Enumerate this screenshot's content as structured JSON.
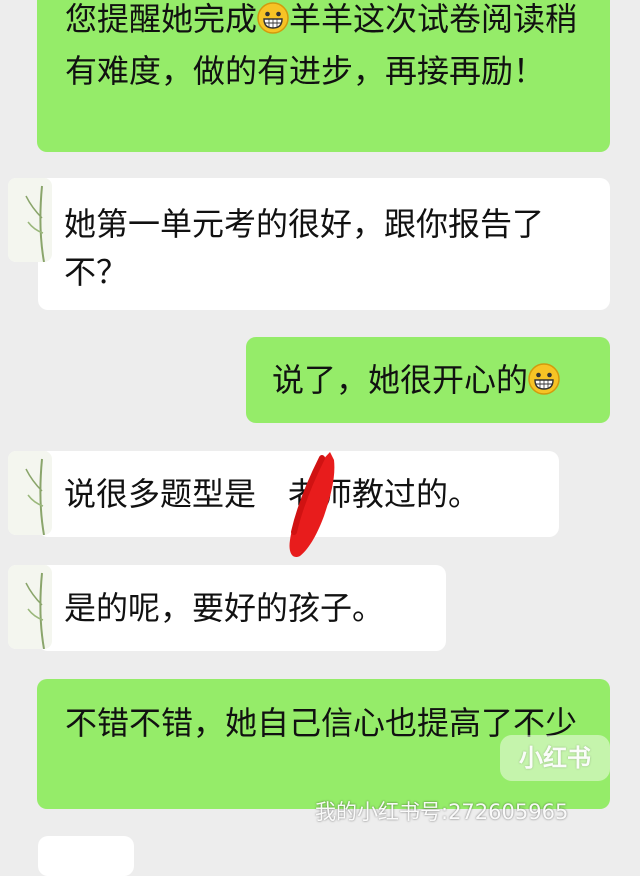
{
  "messages": [
    {
      "side": "right",
      "text": "您提醒她完成😁羊羊这次试卷阅读稍有难度，做的有进步，再接再励！",
      "parts": [
        "您提醒她完成",
        "羊羊这次试卷阅读稍有难度，做的有进步，再接再励！"
      ]
    },
    {
      "side": "left",
      "text": "她第一单元考的很好，跟你报告了不？"
    },
    {
      "side": "right",
      "text": "说了，她很开心的😁"
    },
    {
      "side": "left",
      "text": "说很多题型是老师教过的。",
      "parts": [
        "说很多题型是",
        "老师教过的。"
      ]
    },
    {
      "side": "left",
      "text": "是的呢，要好的孩子。"
    },
    {
      "side": "right",
      "text": "不错不错，她自己信心也提高了不少"
    }
  ],
  "watermark": {
    "logo": "小红书",
    "id_text": "我的小红书号:272605965"
  },
  "colors": {
    "background": "#ededed",
    "sent_bubble": "#95ec69",
    "received_bubble": "#ffffff",
    "redaction": "#e81c1c"
  },
  "icons": {
    "emoji": "grinning-face-emoji",
    "avatar": "plant-avatar"
  }
}
